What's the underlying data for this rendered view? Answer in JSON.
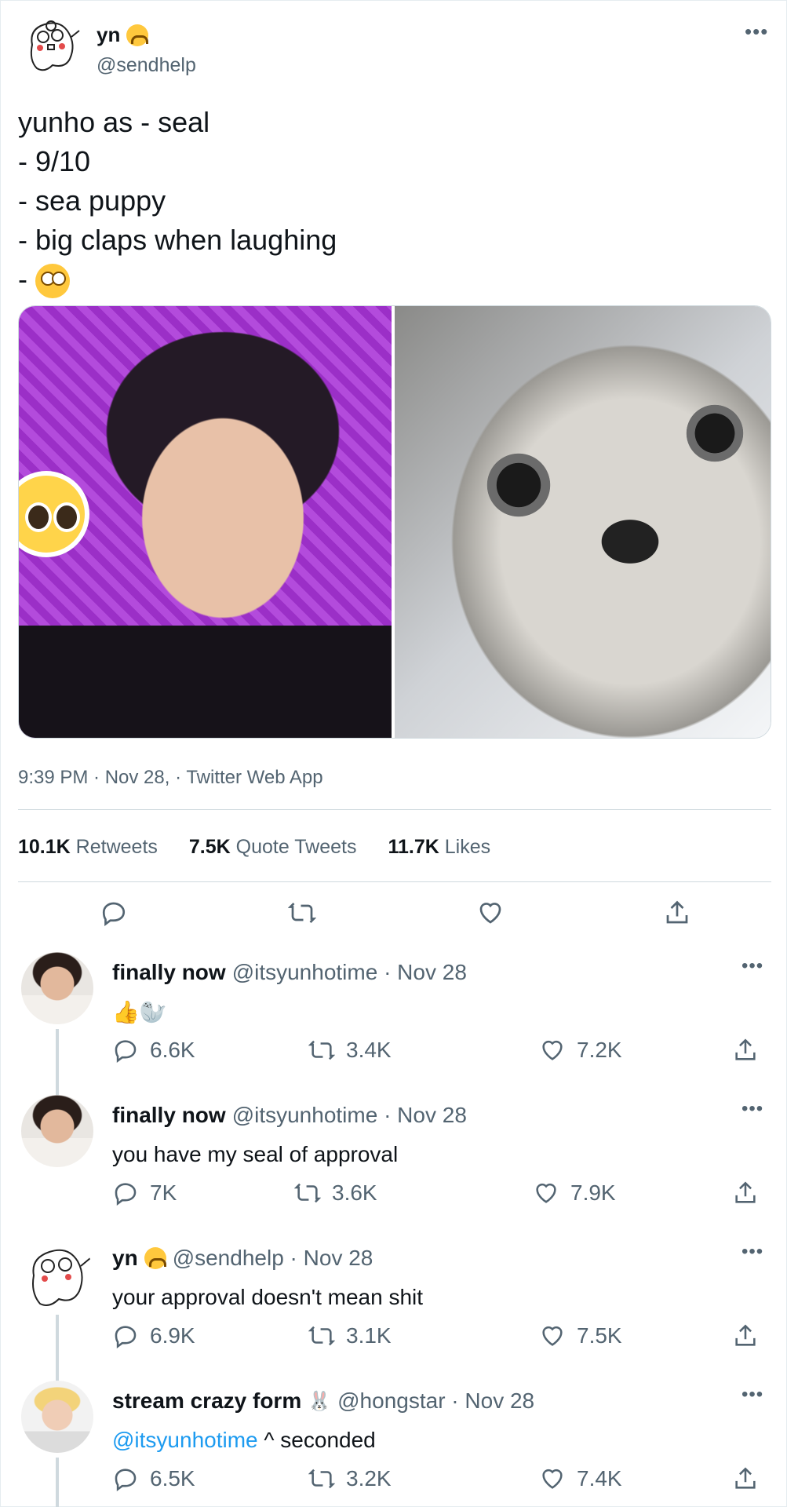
{
  "author": {
    "name": "yn",
    "handle": "@sendhelp"
  },
  "tweet": {
    "lines": [
      "yunho as - seal",
      "- 9/10",
      "- sea puppy",
      "- big claps when laughing",
      "- "
    ],
    "meta": "9:39 PM · Nov 28, · Twitter Web App"
  },
  "stats": [
    {
      "count": "10.1K",
      "label": "Retweets"
    },
    {
      "count": "7.5K",
      "label": "Quote Tweets"
    },
    {
      "count": "11.7K",
      "label": "Likes"
    }
  ],
  "icons": {
    "reply": "reply-icon",
    "retweet": "retweet-icon",
    "like": "heart-icon",
    "share": "share-icon",
    "more": "more-icon"
  },
  "colors": {
    "link": "#1d9bf0",
    "secondary": "#536471",
    "border": "#cfd9de"
  },
  "replies": [
    {
      "name": "finally now",
      "handle": "@itsyunhotime · Nov 28",
      "text": "👍🦭",
      "replies": "6.6K",
      "retweets": "3.4K",
      "likes": "7.2K"
    },
    {
      "name": "finally now",
      "handle": "@itsyunhotime · Nov 28",
      "text": "you have my seal of approval",
      "replies": "7K",
      "retweets": "3.6K",
      "likes": "7.9K"
    },
    {
      "name": "yn",
      "handle": "@sendhelp · Nov 28",
      "text": "your approval doesn't mean shit",
      "replies": "6.9K",
      "retweets": "3.1K",
      "likes": "7.5K"
    },
    {
      "name": "stream crazy form",
      "handle": "@hongstar · Nov 28",
      "mention": "@itsyunhotime",
      "text": " ^ seconded",
      "replies": "6.5K",
      "retweets": "3.2K",
      "likes": "7.4K"
    }
  ],
  "more_glyph": "•••"
}
